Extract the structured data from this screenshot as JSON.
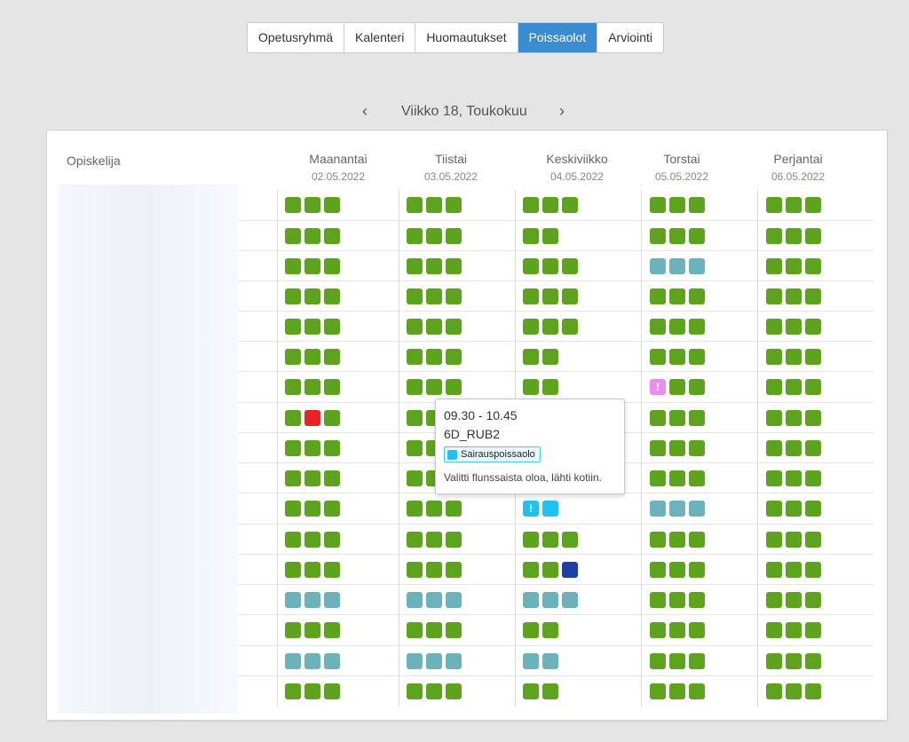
{
  "tabs": [
    {
      "label": "Opetusryhmä",
      "active": false
    },
    {
      "label": "Kalenteri",
      "active": false
    },
    {
      "label": "Huomautukset",
      "active": false
    },
    {
      "label": "Poissaolot",
      "active": true
    },
    {
      "label": "Arviointi",
      "active": false
    }
  ],
  "week_nav": {
    "prev": "‹",
    "label": "Viikko 18, Toukokuu",
    "next": "›"
  },
  "student_column_header": "Opiskelija",
  "days": [
    {
      "name": "Maanantai",
      "date": "02.05.2022"
    },
    {
      "name": "Tiistai",
      "date": "03.05.2022"
    },
    {
      "name": "Keskiviikko",
      "date": "04.05.2022"
    },
    {
      "name": "Torstai",
      "date": "05.05.2022"
    },
    {
      "name": "Perjantai",
      "date": "06.05.2022"
    }
  ],
  "status_colors": {
    "present": "#5ea31d",
    "other": "#6cb2bb",
    "absent": "#e72424",
    "sick": "#1fc1ef",
    "note": "#ec8ced",
    "excused": "#1d3fa8"
  },
  "marker_glyph": "!",
  "attendance": [
    [
      [
        "present",
        "present",
        "present"
      ],
      [
        "present",
        "present",
        "present"
      ],
      [
        "present",
        "present",
        "present"
      ],
      [
        "present",
        "present",
        "present"
      ],
      [
        "present",
        "present",
        "present"
      ]
    ],
    [
      [
        "present",
        "present",
        "present"
      ],
      [
        "present",
        "present",
        "present"
      ],
      [
        "present",
        "present"
      ],
      [
        "present",
        "present",
        "present"
      ],
      [
        "present",
        "present",
        "present"
      ]
    ],
    [
      [
        "present",
        "present",
        "present"
      ],
      [
        "present",
        "present",
        "present"
      ],
      [
        "present",
        "present",
        "present"
      ],
      [
        "other",
        "other",
        "other"
      ],
      [
        "present",
        "present",
        "present"
      ]
    ],
    [
      [
        "present",
        "present",
        "present"
      ],
      [
        "present",
        "present",
        "present"
      ],
      [
        "present",
        "present",
        "present"
      ],
      [
        "present",
        "present",
        "present"
      ],
      [
        "present",
        "present",
        "present"
      ]
    ],
    [
      [
        "present",
        "present",
        "present"
      ],
      [
        "present",
        "present",
        "present"
      ],
      [
        "present",
        "present",
        "present"
      ],
      [
        "present",
        "present",
        "present"
      ],
      [
        "present",
        "present",
        "present"
      ]
    ],
    [
      [
        "present",
        "present",
        "present"
      ],
      [
        "present",
        "present",
        "present"
      ],
      [
        "present",
        "present"
      ],
      [
        "present",
        "present",
        "present"
      ],
      [
        "present",
        "present",
        "present"
      ]
    ],
    [
      [
        "present",
        "present",
        "present"
      ],
      [
        "present",
        "present",
        "present"
      ],
      [
        "present",
        "present"
      ],
      [
        "note!",
        "present",
        "present"
      ],
      [
        "present",
        "present",
        "present"
      ]
    ],
    [
      [
        "present",
        "absent",
        "present"
      ],
      [
        "present",
        "present",
        "present"
      ],
      [
        "present",
        "present",
        "present"
      ],
      [
        "present",
        "present",
        "present"
      ],
      [
        "present",
        "present",
        "present"
      ]
    ],
    [
      [
        "present",
        "present",
        "present"
      ],
      [
        "present",
        "present",
        "present"
      ],
      [
        "present",
        "present",
        "present"
      ],
      [
        "present",
        "present",
        "present"
      ],
      [
        "present",
        "present",
        "present"
      ]
    ],
    [
      [
        "present",
        "present",
        "present"
      ],
      [
        "present",
        "present",
        "present"
      ],
      [
        "present",
        "present",
        "present"
      ],
      [
        "present",
        "present",
        "present"
      ],
      [
        "present",
        "present",
        "present"
      ]
    ],
    [
      [
        "present",
        "present",
        "present"
      ],
      [
        "present",
        "present",
        "present"
      ],
      [
        "sick!",
        "sick"
      ],
      [
        "other",
        "other",
        "other"
      ],
      [
        "present",
        "present",
        "present"
      ]
    ],
    [
      [
        "present",
        "present",
        "present"
      ],
      [
        "present",
        "present",
        "present"
      ],
      [
        "present",
        "present",
        "present"
      ],
      [
        "present",
        "present",
        "present"
      ],
      [
        "present",
        "present",
        "present"
      ]
    ],
    [
      [
        "present",
        "present",
        "present"
      ],
      [
        "present",
        "present",
        "present"
      ],
      [
        "present",
        "present",
        "excused"
      ],
      [
        "present",
        "present",
        "present"
      ],
      [
        "present",
        "present",
        "present"
      ]
    ],
    [
      [
        "other",
        "other",
        "other"
      ],
      [
        "other",
        "other",
        "other"
      ],
      [
        "other",
        "other",
        "other"
      ],
      [
        "present",
        "present",
        "present"
      ],
      [
        "present",
        "present",
        "present"
      ]
    ],
    [
      [
        "present",
        "present",
        "present"
      ],
      [
        "present",
        "present",
        "present"
      ],
      [
        "present",
        "present"
      ],
      [
        "present",
        "present",
        "present"
      ],
      [
        "present",
        "present",
        "present"
      ]
    ],
    [
      [
        "other",
        "other",
        "other"
      ],
      [
        "other",
        "other",
        "other"
      ],
      [
        "other",
        "other"
      ],
      [
        "present",
        "present",
        "present"
      ],
      [
        "present",
        "present",
        "present"
      ]
    ],
    [
      [
        "present",
        "present",
        "present"
      ],
      [
        "present",
        "present",
        "present"
      ],
      [
        "present",
        "present"
      ],
      [
        "present",
        "present",
        "present"
      ],
      [
        "present",
        "present",
        "present"
      ]
    ]
  ],
  "tooltip": {
    "time": "09.30 - 10.45",
    "course": "6D_RUB2",
    "badge": "Sairauspoissaolo",
    "badge_color": "#1fc1ef",
    "note": "Valitti flunssaista oloa, lähti kotiin."
  }
}
